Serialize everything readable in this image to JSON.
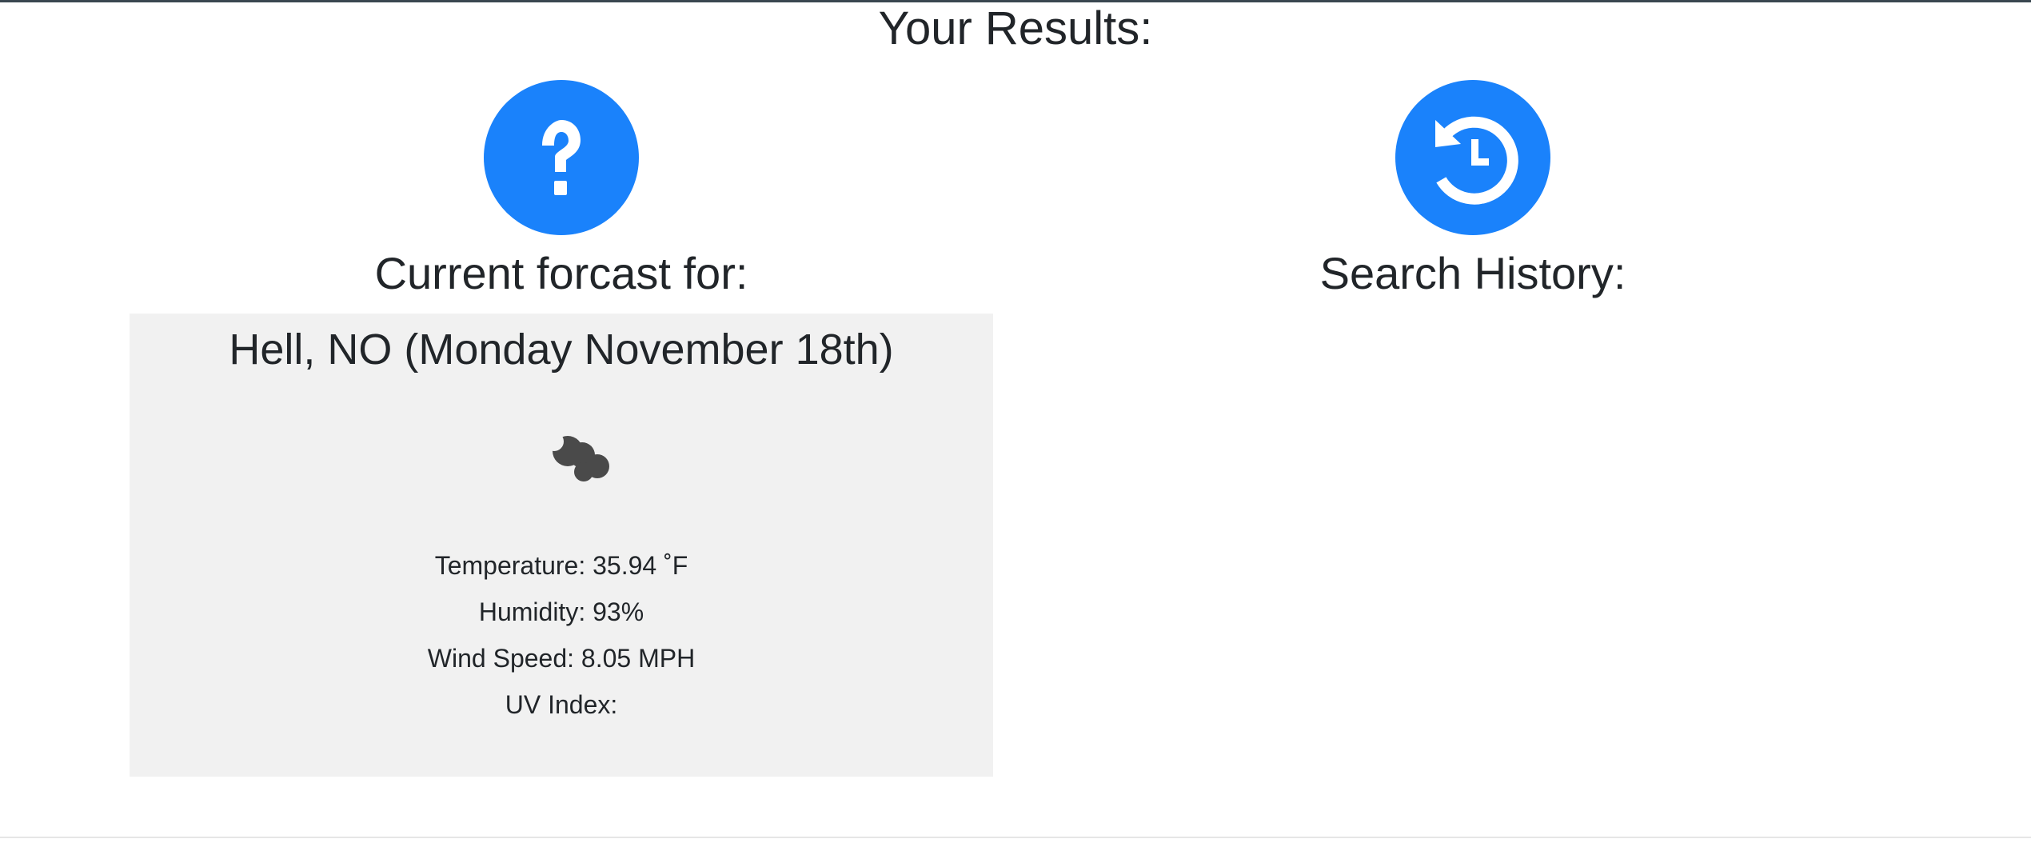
{
  "page": {
    "title": "Your Results:"
  },
  "current": {
    "icon": "question-circle-icon",
    "heading": "Current forcast for:",
    "card": {
      "title": "Hell, NO (Monday November 18th)",
      "weather_icon": "cloudy-night-icon",
      "temperature": "Temperature: 35.94 ˚F",
      "humidity": "Humidity: 93%",
      "wind_speed": "Wind Speed: 8.05 MPH",
      "uv_index": "UV Index:"
    }
  },
  "history": {
    "icon": "history-icon",
    "heading": "Search History:",
    "items": []
  },
  "colors": {
    "accent": "#1a82fb",
    "card_background": "#f1f1f1",
    "text": "#212529"
  }
}
